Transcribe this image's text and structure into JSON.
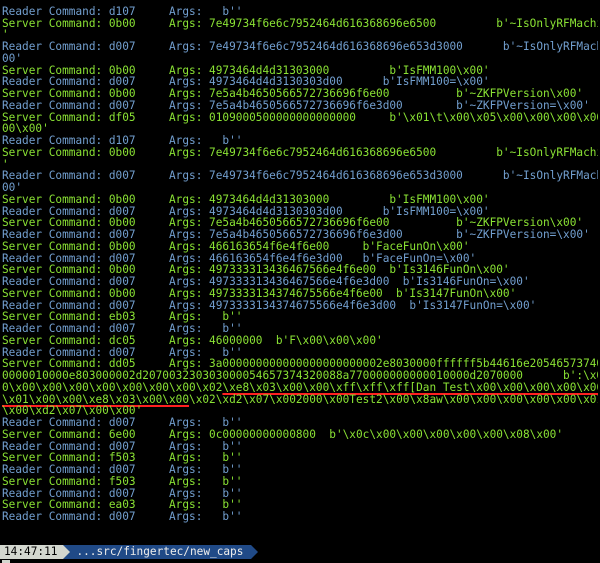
{
  "terminal": {
    "lines": [
      {
        "t": "srv",
        "text": "'"
      },
      {
        "t": "rdr",
        "text": "Reader Command: d107     Args:   b''"
      },
      {
        "t": "srv",
        "text": "Server Command: 0b00     Args: 7e49734f6e6c7952464d616368696e6500         b'~IsOnlyRFMachine\\x00"
      },
      {
        "t": "srv",
        "text": "'"
      },
      {
        "t": "rdr",
        "text": "Reader Command: d007     Args: 7e49734f6e6c7952464d616368696e653d3000      b'~IsOnlyRFMachine=0\\x"
      },
      {
        "t": "rdr",
        "text": "00'"
      },
      {
        "t": "srv",
        "text": "Server Command: 0b00     Args: 4973464d4d31303000         b'IsFMM100\\x00'"
      },
      {
        "t": "rdr",
        "text": "Reader Command: d007     Args: 4973464d4d3130303d00      b'IsFMM100=\\x00'"
      },
      {
        "t": "srv",
        "text": "Server Command: 0b00     Args: 7e5a4b4650566572736696f6e00          b'~ZKFPVersion\\x00'"
      },
      {
        "t": "rdr",
        "text": "Reader Command: d007     Args: 7e5a4b4650566572736696f6e3d00        b'~ZKFPVersion=\\x00'"
      },
      {
        "t": "srv",
        "text": "Server Command: df05     Args: 0109000500000000000000     b'\\x01\\t\\x00\\x05\\x00\\x00\\x00\\x00\\x"
      },
      {
        "t": "srv",
        "text": "00\\x00'"
      },
      {
        "t": "rdr",
        "text": "Reader Command: d107     Args:   b''"
      },
      {
        "t": "srv",
        "text": "Server Command: 0b00     Args: 7e49734f6e6c7952464d616368696e6500         b'~IsOnlyRFMachine\\x00"
      },
      {
        "t": "srv",
        "text": "'"
      },
      {
        "t": "rdr",
        "text": "Reader Command: d007     Args: 7e49734f6e6c7952464d616368696e653d3000      b'~IsOnlyRFMachine=0\\x"
      },
      {
        "t": "rdr",
        "text": "00'"
      },
      {
        "t": "srv",
        "text": "Server Command: 0b00     Args: 4973464d4d31303000         b'IsFMM100\\x00'"
      },
      {
        "t": "rdr",
        "text": "Reader Command: d007     Args: 4973464d4d3130303d00      b'IsFMM100=\\x00'"
      },
      {
        "t": "srv",
        "text": "Server Command: 0b00     Args: 7e5a4b4650566572736696f6e00          b'~ZKFPVersion\\x00'"
      },
      {
        "t": "rdr",
        "text": "Reader Command: d007     Args: 7e5a4b4650566572736696f6e3d00        b'~ZKFPVersion=\\x00'"
      },
      {
        "t": "srv",
        "text": "Server Command: 0b00     Args: 466163654f6e4f6e00     b'FaceFunOn\\x00'"
      },
      {
        "t": "rdr",
        "text": "Reader Command: d007     Args: 466163654f6e4f6e3d00   b'FaceFunOn=\\x00'"
      },
      {
        "t": "srv",
        "text": "Server Command: 0b00     Args: 497333313436467566e4f6e00  b'Is3146FunOn\\x00'"
      },
      {
        "t": "rdr",
        "text": "Reader Command: d007     Args: 497333313436467566e4f6e3d00  b'Is3146FunOn=\\x00'"
      },
      {
        "t": "srv",
        "text": "Server Command: 0b00     Args: 4973333134374675566e4f6e00  b'Is3147FunOn\\x00'"
      },
      {
        "t": "rdr",
        "text": "Reader Command: d007     Args: 4973333134374675566e4f6e3d00  b'Is3147FunOn=\\x00'"
      },
      {
        "t": "srv",
        "text": "Server Command: eb03     Args:   b''"
      },
      {
        "t": "rdr",
        "text": "Reader Command: d007     Args:   b''"
      },
      {
        "t": "srv",
        "text": "Server Command: dc05     Args: 46000000  b'F\\x00\\x00\\x00'"
      },
      {
        "t": "rdr",
        "text": "Reader Command: d007     Args:   b''"
      },
      {
        "t": "srv",
        "text": "Server Command: dd05     Args: 3a000000000000000000000002e8030000ffffff5b44616e2054657374000000"
      },
      {
        "t": "srv",
        "text": "0000010000e803000002d207003230303000054657374320088a770000000000010000d2070000      b':\\x00\\x00\\x0"
      },
      {
        "t": "srv",
        "pre": "0\\x00\\x00\\x00\\x00\\x00\\x00\\x00\\x02",
        "ul": "\\xe8\\x03\\x00\\x00\\xff\\xff\\xff[Dan Test\\x00\\x00\\x00\\x00\\x00",
        "post": ""
      },
      {
        "t": "srv",
        "pre": "",
        "ul": "\\x01\\x00\\x00\\xe8\\x03\\x00\\x00",
        "post": "\\x02\\xd2\\x07\\x002000\\x00Test2\\x00\\x8aw\\x00\\x00\\x00\\x00\\x00\\x01\\x00"
      },
      {
        "t": "srv",
        "text": "\\x00\\xd2\\x07\\x00\\x00'"
      },
      {
        "t": "rdr",
        "text": "Reader Command: d007     Args:   b''"
      },
      {
        "t": "srv",
        "text": "Server Command: 6e00     Args: 0c00000000000800  b'\\x0c\\x00\\x00\\x00\\x00\\x00\\x08\\x00'"
      },
      {
        "t": "rdr",
        "text": "Reader Command: d007     Args:   b''"
      },
      {
        "t": "srv",
        "text": "Server Command: f503     Args:   b''"
      },
      {
        "t": "rdr",
        "text": "Reader Command: d007     Args:   b''"
      },
      {
        "t": "srv",
        "text": "Server Command: f503     Args:   b''"
      },
      {
        "t": "rdr",
        "text": "Reader Command: d007     Args:   b''"
      },
      {
        "t": "srv",
        "text": "Server Command: ea03     Args:   b''"
      },
      {
        "t": "rdr",
        "text": "Reader Command: d007     Args:   b''"
      },
      {
        "t": "srv",
        "text": ""
      }
    ]
  },
  "prompt": {
    "time": "14:47:11",
    "path": "...src/fingertec/new_caps"
  },
  "colors": {
    "server": "#8ae234",
    "reader": "#729fcf",
    "underline": "#ff2020",
    "background": "#000000"
  }
}
